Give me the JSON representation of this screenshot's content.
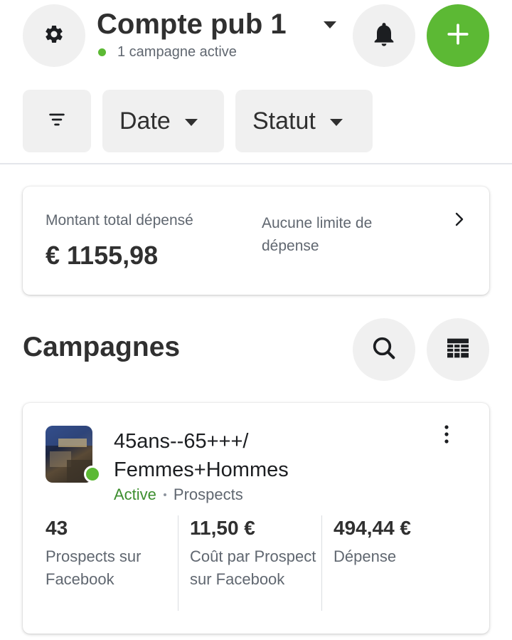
{
  "header": {
    "account_name": "Compte pub 1",
    "status_text": "1 campagne active",
    "icons": {
      "settings": "gear-icon",
      "notifications": "bell-icon",
      "add": "plus-icon"
    },
    "accent_color": "#5cb934"
  },
  "filters": {
    "filter_icon": "filter-icon",
    "date_label": "Date",
    "status_label": "Statut"
  },
  "spend_summary": {
    "label": "Montant total dépensé",
    "value": "€ 1155,98",
    "limit_text": "Aucune limite de dépense"
  },
  "campaigns_section": {
    "title": "Campagnes",
    "search_icon": "search-icon",
    "table_icon": "table-icon"
  },
  "campaign": {
    "name": "45ans--65+++/ Femmes+Hommes",
    "status": "Active",
    "objective": "Prospects",
    "metrics": [
      {
        "value": "43",
        "label": "Prospects sur Facebook"
      },
      {
        "value": "11,50 €",
        "label": "Coût par Prospect sur Facebook"
      },
      {
        "value": "494,44 €",
        "label": "Dépense"
      }
    ]
  }
}
